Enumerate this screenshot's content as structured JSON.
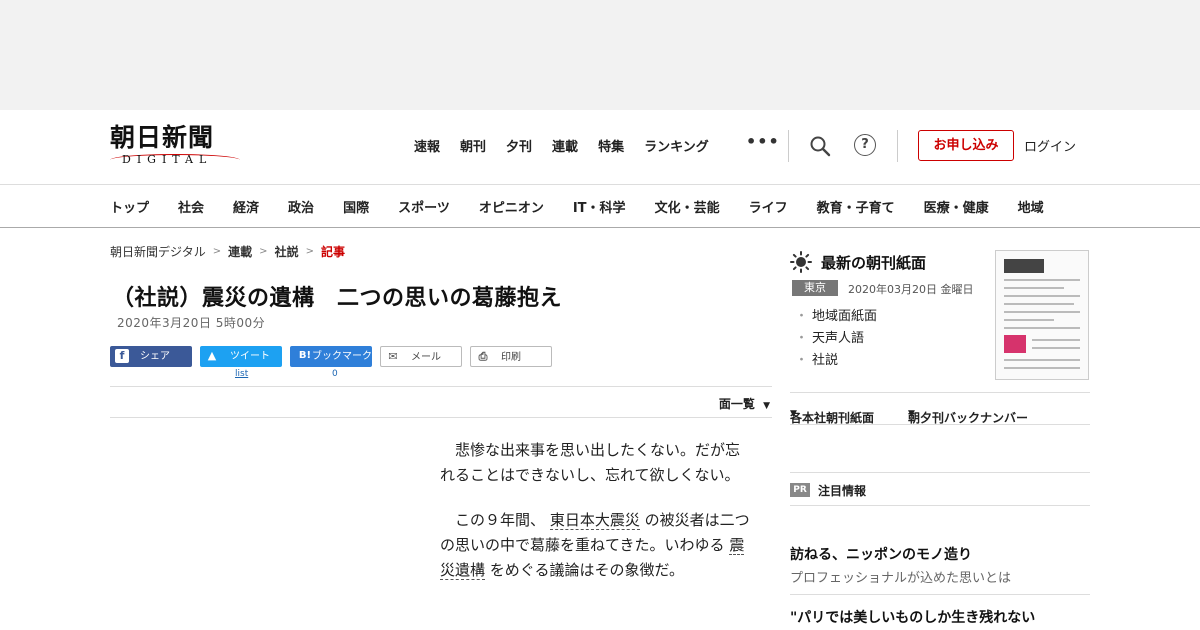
{
  "header": {
    "logo_text": "朝日新聞",
    "logo_sub": "DIGITAL",
    "top_nav": [
      "速報",
      "朝刊",
      "夕刊",
      "連載",
      "特集",
      "ランキング"
    ],
    "more": "•••",
    "help": "?",
    "signup": "お申し込み",
    "login": "ログイン"
  },
  "categories": [
    "トップ",
    "社会",
    "経済",
    "政治",
    "国際",
    "スポーツ",
    "オピニオン",
    "IT・科学",
    "文化・芸能",
    "ライフ",
    "教育・子育て",
    "医療・健康",
    "地域"
  ],
  "breadcrumb": [
    "朝日新聞デジタル",
    "連載",
    "社説",
    "記事"
  ],
  "article": {
    "title": "（社説）震災の遺構　二つの思いの葛藤抱え",
    "date": "2020年3月20日 5時00分",
    "share": {
      "facebook": "シェア",
      "twitter": "ツイート",
      "hatena": "ブックマーク",
      "mail": "メール",
      "print": "印刷",
      "twitter_count": "list",
      "hatena_count": "0"
    },
    "men_link": "面一覧",
    "p1": "悲惨な出来事を思い出したくない。だが忘れることはできないし、忘れて欲しくない。",
    "p2_a": "この９年間、",
    "p2_link1": "東日本大震災",
    "p2_b": "の被災者は二つの思いの中で葛藤を重ねてきた。いわゆる",
    "p2_link2": "震災遺構",
    "p2_c": "をめぐる議論はその象徴だ。"
  },
  "sidebar": {
    "title": "最新の朝刊紙面",
    "region": "東京",
    "date": "2020年03月20日 金曜日",
    "links": [
      "地域面紙面",
      "天声人語",
      "社説"
    ],
    "menu1": "各本社朝刊紙面",
    "menu2": "朝夕刊バックナンバー",
    "pr_tag": "PR",
    "pr_label": "注目情報",
    "promo1_title": "訪ねる、ニッポンのモノ造り",
    "promo1_sub": "プロフェッショナルが込めた思いとは",
    "promo2_title": "\"パリでは美しいものしか生き残れない"
  }
}
